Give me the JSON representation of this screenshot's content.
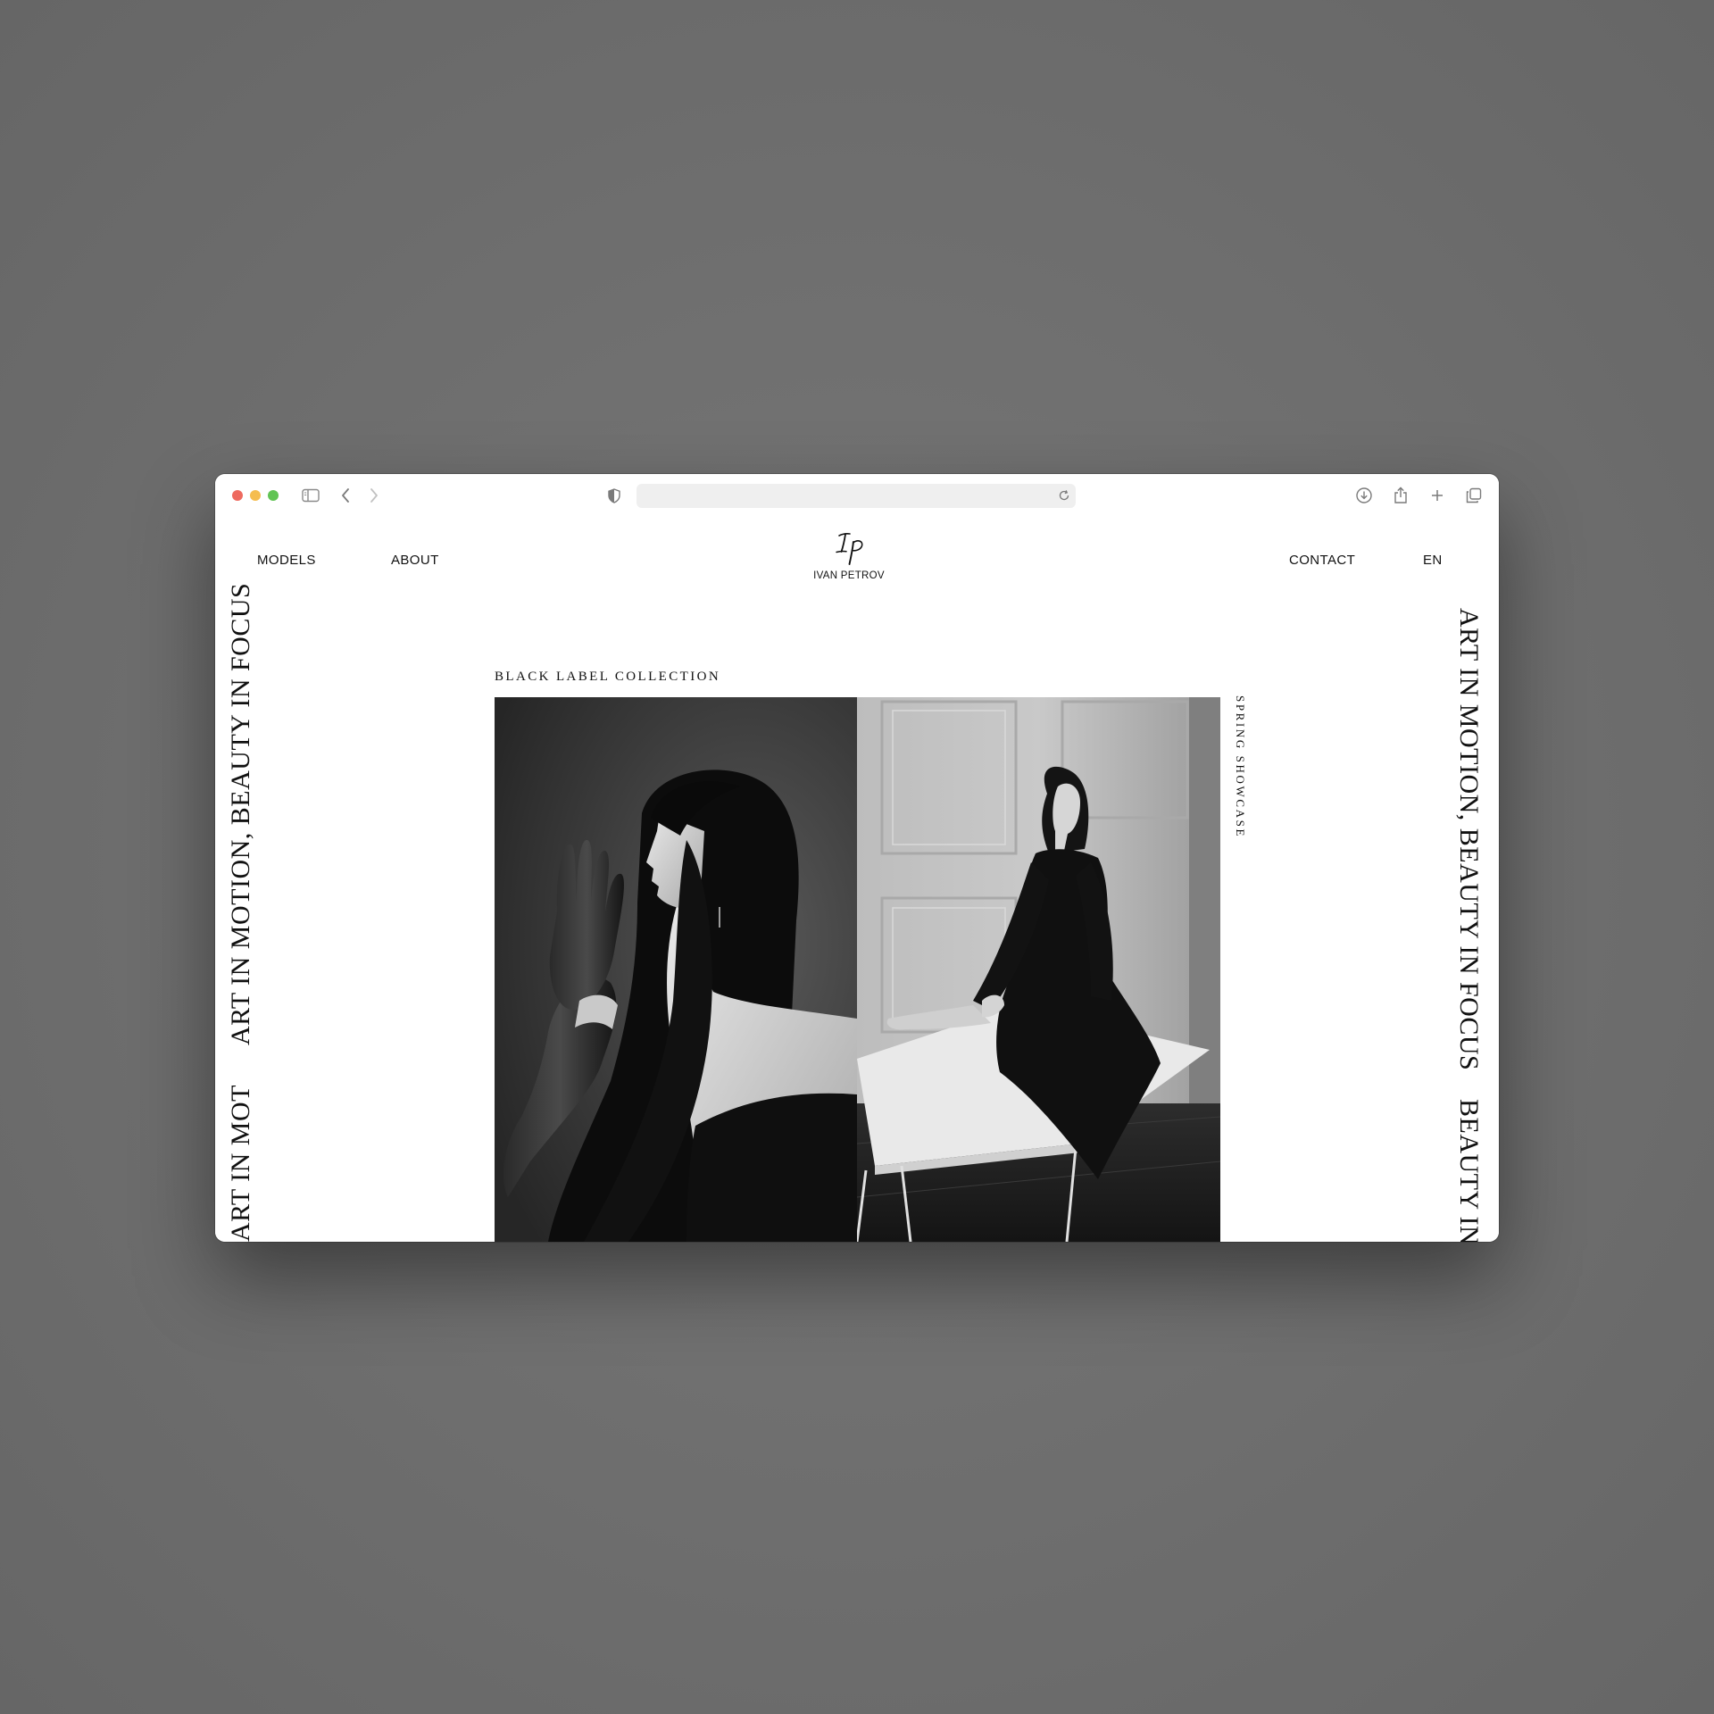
{
  "browser": {
    "address_value": "",
    "icons": {
      "sidebar": "sidebar-icon",
      "back": "chevron-left-icon",
      "forward": "chevron-right-icon",
      "privacy": "shield-icon",
      "reload": "reload-icon",
      "downloads": "download-icon",
      "share": "share-icon",
      "new_tab": "plus-icon",
      "tabs": "tabs-overview-icon"
    }
  },
  "site": {
    "nav": {
      "models": "MODELS",
      "about": "ABOUT",
      "contact": "CONTACT",
      "language": "EN"
    },
    "logo": {
      "monogram": "IP",
      "name": "IVAN PETROV"
    },
    "tagline": "ART IN MOTION, BEAUTY IN FOCUS",
    "tagline_fragment_left": "ART IN MOT",
    "tagline_fragment_right": "ART IN MOTION, BEAUTY IN FOCUS",
    "collection": {
      "title": "BLACK LABEL COLLECTION",
      "side_caption": "SPRING SHOWCASE"
    },
    "photos": [
      {
        "subject": "model in profile with black leather gloves"
      },
      {
        "subject": "model in black dress seated on white table"
      }
    ]
  },
  "colors": {
    "desktop": "#6f6f6f",
    "page_bg": "#ffffff",
    "text": "#111111",
    "address_bar": "#efefef",
    "traffic_red": "#ee6a5f",
    "traffic_yellow": "#f5bd4f",
    "traffic_green": "#61c454"
  }
}
